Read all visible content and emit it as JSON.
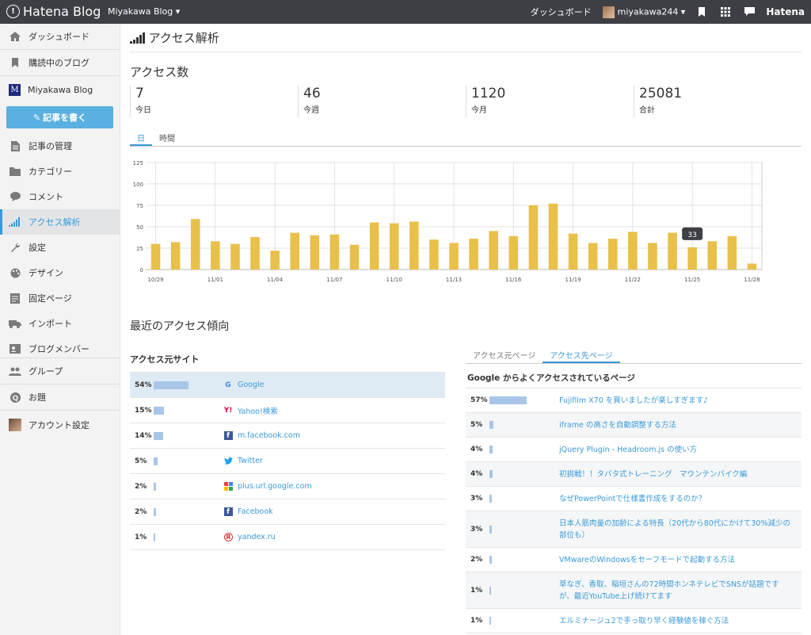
{
  "topbar": {
    "brand": "Hatena Blog",
    "blog_switch": "Miyakawa Blog ▾",
    "dashboard": "ダッシュボード",
    "user": "miyakawa244 ▾",
    "hatena": "Hatena"
  },
  "sidebar": {
    "items": [
      {
        "label": "ダッシュボード",
        "icon": "home-icon"
      },
      {
        "label": "購読中のブログ",
        "icon": "bookmark-icon"
      },
      {
        "label": "Miyakawa Blog",
        "icon": "blog-icon"
      },
      {
        "label": "記事を書く",
        "icon": "edit-icon"
      },
      {
        "label": "記事の管理",
        "icon": "document-icon"
      },
      {
        "label": "カテゴリー",
        "icon": "folder-icon"
      },
      {
        "label": "コメント",
        "icon": "comment-icon"
      },
      {
        "label": "アクセス解析",
        "icon": "signal-icon"
      },
      {
        "label": "設定",
        "icon": "wrench-icon"
      },
      {
        "label": "デザイン",
        "icon": "palette-icon"
      },
      {
        "label": "固定ページ",
        "icon": "page-icon"
      },
      {
        "label": "インポート",
        "icon": "truck-icon"
      },
      {
        "label": "ブログメンバー",
        "icon": "member-icon"
      },
      {
        "label": "グループ",
        "icon": "group-icon"
      },
      {
        "label": "お題",
        "icon": "question-icon"
      },
      {
        "label": "アカウント設定",
        "icon": "avatar-icon"
      }
    ]
  },
  "main": {
    "title": "アクセス解析",
    "access_title": "アクセス数",
    "stats": [
      {
        "num": "7",
        "label": "今日"
      },
      {
        "num": "46",
        "label": "今週"
      },
      {
        "num": "1120",
        "label": "今月"
      },
      {
        "num": "25081",
        "label": "合計"
      }
    ],
    "tabs": [
      "日",
      "時間"
    ],
    "trend_title": "最近のアクセス傾向",
    "source_title": "アクセス元サイト",
    "sources": [
      {
        "pct": "54%",
        "value": 54,
        "site": "Google",
        "icon": "google-icon"
      },
      {
        "pct": "15%",
        "value": 15,
        "site": "Yahoo!検索",
        "icon": "yahoo-icon"
      },
      {
        "pct": "14%",
        "value": 14,
        "site": "m.facebook.com",
        "icon": "facebook-icon"
      },
      {
        "pct": "5%",
        "value": 5,
        "site": "Twitter",
        "icon": "twitter-icon"
      },
      {
        "pct": "2%",
        "value": 2,
        "site": "plus.url.google.com",
        "icon": "google-plus-icon"
      },
      {
        "pct": "2%",
        "value": 2,
        "site": "Facebook",
        "icon": "facebook-icon"
      },
      {
        "pct": "1%",
        "value": 1,
        "site": "yandex.ru",
        "icon": "yandex-icon"
      }
    ],
    "right_tabs": [
      "アクセス元ページ",
      "アクセス先ページ"
    ],
    "dest_title": "Google からよくアクセスされているページ",
    "destinations": [
      {
        "pct": "57%",
        "value": 57,
        "page": "Fujifilm X70 を買いましたが楽しすぎます♪"
      },
      {
        "pct": "5%",
        "value": 5,
        "page": "iframe の高さを自動調整する方法"
      },
      {
        "pct": "4%",
        "value": 4,
        "page": "jQuery Plugin - Headroom.js の使い方"
      },
      {
        "pct": "4%",
        "value": 4,
        "page": "初挑戦！！タバタ式トレーニング　マウンテンバイク編"
      },
      {
        "pct": "3%",
        "value": 3,
        "page": "なぜPowerPointで仕様書作成をするのか？"
      },
      {
        "pct": "3%",
        "value": 3,
        "page": "日本人筋肉量の加齢による特長（20代から80代にかけて30%減少の部位も）"
      },
      {
        "pct": "2%",
        "value": 2,
        "page": "VMwareのWindowsをセーフモードで起動する方法"
      },
      {
        "pct": "1%",
        "value": 1,
        "page": "草なぎ、香取、稲垣さんの72時間ホンネテレビでSNSが話題ですが、最近YouTube上げ続けてます"
      },
      {
        "pct": "1%",
        "value": 1,
        "page": "エルミナージュ2で手っ取り早く経験値を稼ぐ方法"
      }
    ]
  },
  "chart_data": {
    "type": "bar",
    "color": "#e8c04a",
    "x_tick_labels": [
      "10/29",
      "11/01",
      "11/04",
      "11/07",
      "11/10",
      "11/13",
      "11/16",
      "11/19",
      "11/22",
      "11/25",
      "11/28"
    ],
    "y_ticks": [
      "0",
      "25",
      "50",
      "75",
      "100",
      "125"
    ],
    "ylim": [
      0,
      125
    ],
    "values": [
      30,
      32,
      59,
      33,
      30,
      38,
      22,
      43,
      40,
      41,
      29,
      55,
      54,
      56,
      35,
      31,
      36,
      45,
      39,
      75,
      77,
      42,
      31,
      36,
      44,
      31,
      43,
      26,
      33,
      39,
      7
    ],
    "tooltip": "33"
  }
}
